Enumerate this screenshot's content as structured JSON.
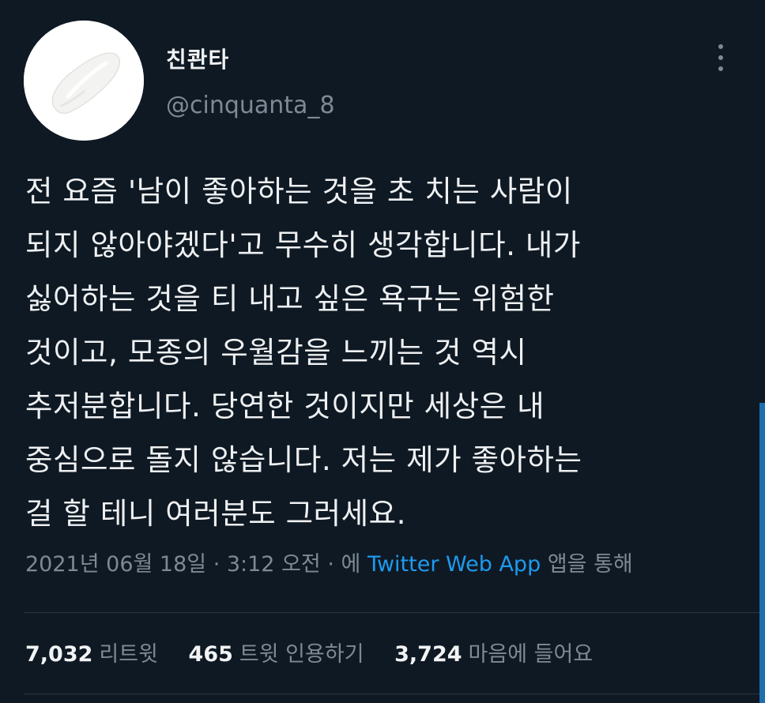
{
  "user": {
    "display_name": "친콴타",
    "handle": "@cinquanta_8",
    "avatar_icon": "cream-swatch-icon"
  },
  "tweet": {
    "lines": [
      "전 요즘 '남이 좋아하는 것을 초 치는 사람이",
      "되지 않아야겠다'고 무수히 생각합니다. 내가",
      "싫어하는 것을 티 내고 싶은 욕구는 위험한",
      "것이고, 모종의 우월감을 느끼는 것 역시",
      "추저분합니다. 당연한 것이지만 세상은 내",
      "중심으로 돌지 않습니다. 저는 제가 좋아하는",
      "걸 할 테니 여러분도 그러세요."
    ],
    "timestamp": "2021년 06월 18일 · 3:12 오전 · 에",
    "source": "Twitter Web App",
    "source_suffix": "앱을 통해"
  },
  "stats": {
    "retweets": {
      "count": "7,032",
      "label": "리트윗"
    },
    "quotes": {
      "count": "465",
      "label": "트윗 인용하기"
    },
    "likes": {
      "count": "3,724",
      "label": "마음에 들어요"
    }
  },
  "colors": {
    "background": "#0f1923",
    "link": "#1d9bf0",
    "muted": "#7d8a96",
    "text": "#eef0f2"
  }
}
